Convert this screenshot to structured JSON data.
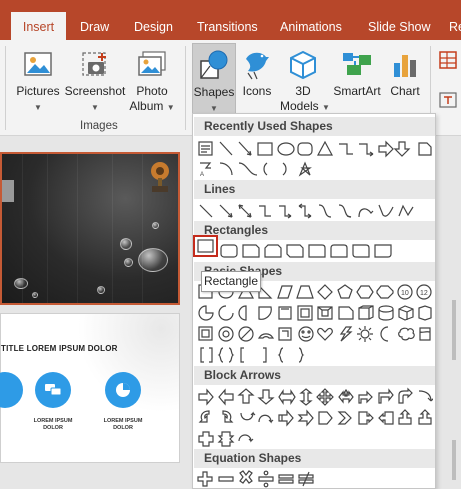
{
  "tabs": [
    {
      "label": "Insert",
      "active": true
    },
    {
      "label": "Draw"
    },
    {
      "label": "Design"
    },
    {
      "label": "Transitions"
    },
    {
      "label": "Animations"
    },
    {
      "label": "Slide Show"
    },
    {
      "label": "Re"
    }
  ],
  "ribbon": {
    "pictures": "Pictures",
    "screenshot": "Screenshot",
    "photo_album_1": "Photo",
    "photo_album_2": "Album",
    "shapes": "Shapes",
    "icons": "Icons",
    "models_1": "3D",
    "models_2": "Models",
    "smartart": "SmartArt",
    "chart": "Chart",
    "group_images": "Images"
  },
  "thumbnail": {
    "title": "TITLE LOREM IPSUM DOLOR",
    "captions": [
      "LOREM IPSUM DOLOR",
      "LOREM IPSUM DOLOR"
    ]
  },
  "gallery": {
    "sections": [
      "Recently Used Shapes",
      "Lines",
      "Rectangles",
      "Basic Shapes",
      "Block Arrows",
      "Equation Shapes"
    ]
  },
  "tooltip": "Rectangle",
  "colors": {
    "accent": "#b7472a",
    "selection": "#c42b1c",
    "icon_blue": "#2e9be6"
  }
}
